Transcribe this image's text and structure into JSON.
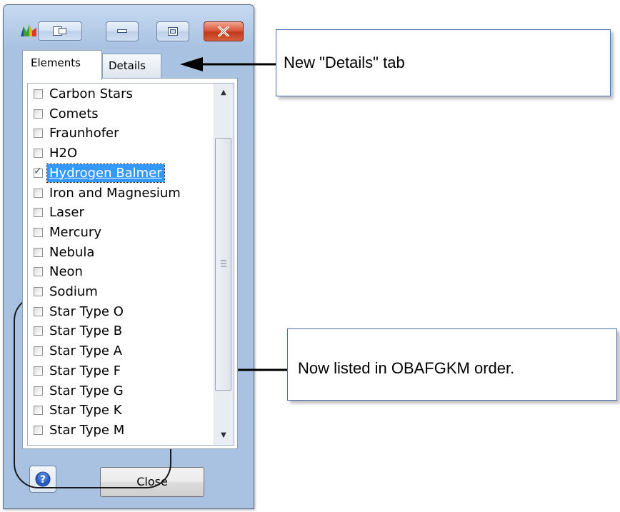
{
  "window": {
    "tabs": [
      {
        "label": "Elements",
        "active": true
      },
      {
        "label": "Details",
        "active": false
      }
    ],
    "list_items": [
      {
        "label": "Carbon Stars",
        "checked": false,
        "selected": false
      },
      {
        "label": "Comets",
        "checked": false,
        "selected": false
      },
      {
        "label": "Fraunhofer",
        "checked": false,
        "selected": false
      },
      {
        "label": "H2O",
        "checked": false,
        "selected": false
      },
      {
        "label": "Hydrogen Balmer",
        "checked": true,
        "selected": true
      },
      {
        "label": "Iron and Magnesium",
        "checked": false,
        "selected": false
      },
      {
        "label": "Laser",
        "checked": false,
        "selected": false
      },
      {
        "label": "Mercury",
        "checked": false,
        "selected": false
      },
      {
        "label": "Nebula",
        "checked": false,
        "selected": false
      },
      {
        "label": "Neon",
        "checked": false,
        "selected": false
      },
      {
        "label": "Sodium",
        "checked": false,
        "selected": false
      },
      {
        "label": "Star Type O",
        "checked": false,
        "selected": false
      },
      {
        "label": "Star Type B",
        "checked": false,
        "selected": false
      },
      {
        "label": "Star Type A",
        "checked": false,
        "selected": false
      },
      {
        "label": "Star Type F",
        "checked": false,
        "selected": false
      },
      {
        "label": "Star Type G",
        "checked": false,
        "selected": false
      },
      {
        "label": "Star Type K",
        "checked": false,
        "selected": false
      },
      {
        "label": "Star Type M",
        "checked": false,
        "selected": false
      }
    ],
    "close_button_label": "Close",
    "icons": {
      "app": "spectrum-app-icon",
      "help": "help-icon",
      "minimize": "minimize-icon",
      "maximize": "maximize-icon",
      "close": "close-x-icon"
    },
    "colors": {
      "frame": "#b3cae6",
      "selection": "#3399ff",
      "close_caption": "#c8462a",
      "annotation_border": "#4a6ea9"
    }
  },
  "annotations": {
    "details_callout": "New \"Details\" tab",
    "order_callout": "Now listed in OBAFGKM order."
  }
}
